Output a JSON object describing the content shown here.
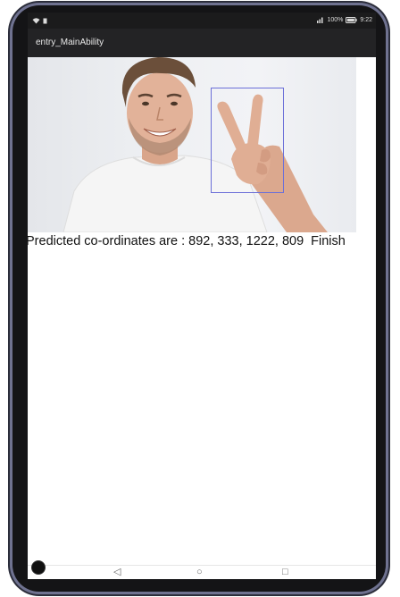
{
  "status_bar": {
    "battery_text": "100%",
    "time": "9:22",
    "icons": [
      "wifi-icon",
      "sim-icon",
      "signal-icon",
      "battery-icon"
    ]
  },
  "app_bar": {
    "title": "entry_MainAbility"
  },
  "image": {
    "subject": "man-making-v-sign",
    "bbox_color": "#6b6fd8"
  },
  "result": {
    "text": "Predicted co-ordinates are : 892, 333, 1222, 809",
    "finish_label": "Finish"
  },
  "nav_bar": {
    "icons": [
      "back-icon",
      "home-icon",
      "recents-icon"
    ]
  }
}
